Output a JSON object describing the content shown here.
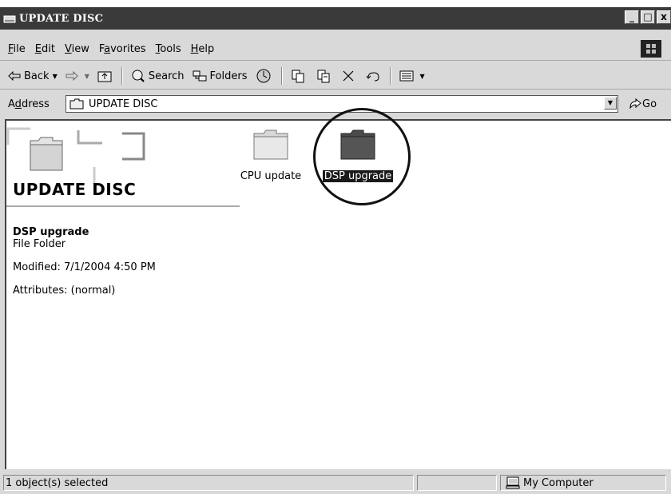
{
  "window": {
    "title": "UPDATE DISC",
    "min": "_",
    "max": "□",
    "close": "x"
  },
  "menu": {
    "file": {
      "u": "F",
      "rest": "ile"
    },
    "edit": {
      "u": "E",
      "rest": "dit"
    },
    "view": {
      "u": "V",
      "rest": "iew"
    },
    "favorites": {
      "pre": "F",
      "u": "a",
      "rest": "vorites"
    },
    "tools": {
      "u": "T",
      "rest": "ools"
    },
    "help": {
      "u": "H",
      "rest": "elp"
    }
  },
  "toolbar": {
    "back": "Back",
    "search": "Search",
    "folders": "Folders"
  },
  "address": {
    "label_pre": "A",
    "label_u": "d",
    "label_rest": "dress",
    "value": "UPDATE DISC",
    "go": "Go"
  },
  "left_pane": {
    "title": "UPDATE DISC",
    "selected_name": "DSP upgrade",
    "selected_type": "File Folder",
    "modified": "Modified: 7/1/2004 4:50 PM",
    "attributes": "Attributes: (normal)"
  },
  "files": [
    {
      "name": "CPU update",
      "selected": false
    },
    {
      "name": "DSP upgrade",
      "selected": true
    }
  ],
  "status": {
    "left": "1 object(s) selected",
    "right": "My Computer"
  }
}
